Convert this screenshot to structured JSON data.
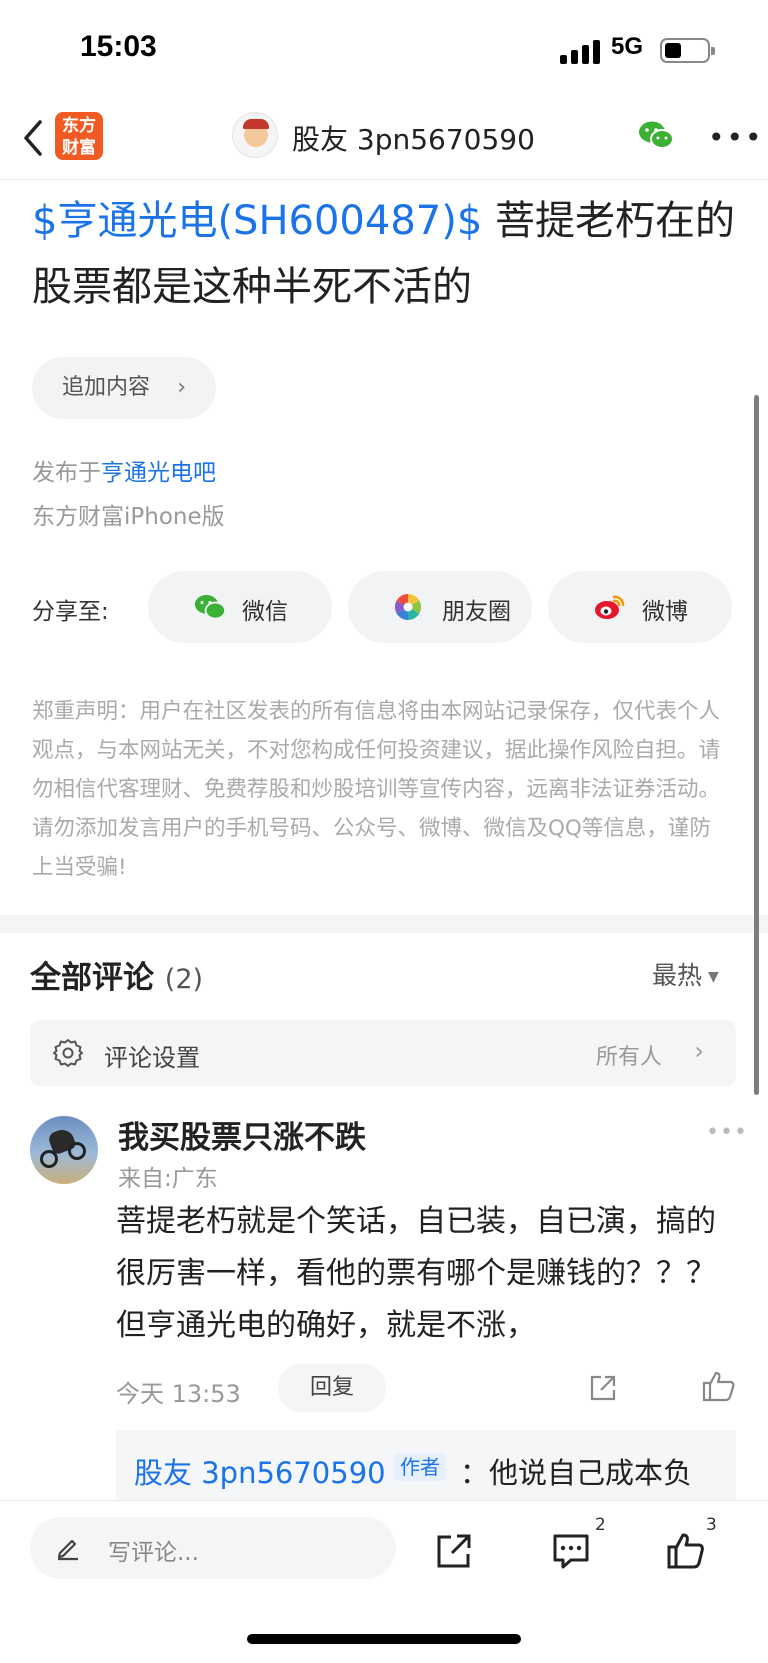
{
  "status_bar": {
    "time": "15:03",
    "network": "5G"
  },
  "nav": {
    "app_logo_line1": "东方",
    "app_logo_line2": "财富",
    "title": "股友 3pn5670590"
  },
  "post": {
    "stock_tag": "$亨通光电(SH600487)$",
    "text": " 菩提老朽在的股票都是这种半死不活的",
    "append_label": "追加内容",
    "published_prefix": "发布于",
    "published_bar": "亨通光电吧",
    "device": "东方财富iPhone版"
  },
  "share": {
    "label": "分享至:",
    "targets": [
      {
        "label": "微信",
        "icon": "wechat-icon"
      },
      {
        "label": "朋友圈",
        "icon": "moments-icon"
      },
      {
        "label": "微博",
        "icon": "weibo-icon"
      }
    ]
  },
  "disclaimer": "郑重声明：用户在社区发表的所有信息将由本网站记录保存，仅代表个人观点，与本网站无关，不对您构成任何投资建议，据此操作风险自担。请勿相信代客理财、免费荐股和炒股培训等宣传内容，远离非法证券活动。请勿添加发言用户的手机号码、公众号、微博、微信及QQ等信息，谨防上当受骗!",
  "comments": {
    "title": "全部评论",
    "count": "(2)",
    "sort": "最热",
    "settings_label": "评论设置",
    "settings_value": "所有人",
    "items": [
      {
        "author": "我买股票只涨不跌",
        "location": "来自:广东",
        "text": "菩提老朽就是个笑话，自已装，自已演，搞的很厉害一样，看他的票有哪个是赚钱的？？？ 但亨通光电的确好，就是不涨，",
        "time": "今天 13:53",
        "reply_label": "回复",
        "sub_reply": {
          "author": "股友 3pn5670590",
          "tag": "作者",
          "separator": "：",
          "text": "他说自己成本负"
        }
      }
    ]
  },
  "bottom_bar": {
    "write_placeholder": "写评论...",
    "comment_count": "2",
    "like_count": "3"
  },
  "colors": {
    "brand_orange": "#f15a22",
    "link_blue": "#1a73e8",
    "wechat_green": "#3cb034",
    "weibo_red": "#e6162d"
  }
}
